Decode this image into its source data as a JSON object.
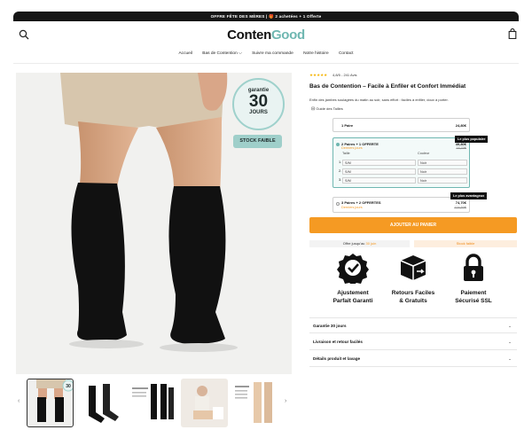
{
  "announcement": "OFFRE FÊTE DES MÈRES | 🎁 2 achetées + 1 Offerte",
  "brand": {
    "part1": "Conten",
    "part2": "Good"
  },
  "nav": [
    "Accueil",
    "Bas de Contention",
    "Suivre ma commande",
    "Notre histoire",
    "Contact"
  ],
  "nav_chevron": "⌵",
  "gallery": {
    "badge_small": "garantie",
    "badge_big": "30",
    "badge_unit": "JOURS",
    "stock_badge": "STOCK FAIBLE",
    "prev": "‹",
    "next": "›",
    "thumb_badge": "30"
  },
  "product": {
    "stars": "★★★★★",
    "rating": "4,8/5 - 241 Avis",
    "title": "Bas de Contention – Facile à Enfiler et Confort Immédiat",
    "description": "Enfin des jambes soulagées du matin au soir, sans effort : faciles à enfiler, doux à porter.",
    "size_guide": "Guide des Tailles"
  },
  "offers": [
    {
      "label": "1 Paire",
      "price": "24,80€",
      "old": "",
      "note": "",
      "tag": ""
    },
    {
      "label": "2 Paires + 1 OFFERTE",
      "price": "49,80€",
      "old": "74,70€",
      "note": "Derniers jours",
      "tag": "Le plus populaire"
    },
    {
      "label": "3 Paires + 2 OFFERTES",
      "price": "74,70€",
      "old": "124,50€",
      "note": "Derniers jours",
      "tag": "Le plus avantageux"
    }
  ],
  "variant_headers": {
    "size": "Taille",
    "color": "Couleur"
  },
  "variants": [
    {
      "n": "1.",
      "size": "S/M",
      "color": "Noir"
    },
    {
      "n": "2.",
      "size": "S/M",
      "color": "Noir"
    },
    {
      "n": "3.",
      "size": "S/M",
      "color": "Noir"
    }
  ],
  "cta": "AJOUTER AU PANIER",
  "offer_until": {
    "prefix": "Offre jusqu'au ",
    "date": "30 juin"
  },
  "stock_low": "Stock faible",
  "features": [
    {
      "icon": "check-badge-icon",
      "line1": "Ajustement",
      "line2": "Parfait Garanti"
    },
    {
      "icon": "return-box-icon",
      "line1": "Retours Faciles",
      "line2": "& Gratuits"
    },
    {
      "icon": "padlock-icon",
      "line1": "Paiement",
      "line2": "Sécurisé SSL"
    }
  ],
  "accordions": [
    "Garantie 30 jours",
    "Livraison et retour facilés",
    "Détails produit et lavage"
  ],
  "chevron": "⌄",
  "colors": {
    "accent": "#f59a23",
    "brand_teal": "#6fb7b1",
    "badge_bg": "#9fcfca",
    "dark": "#161616"
  }
}
